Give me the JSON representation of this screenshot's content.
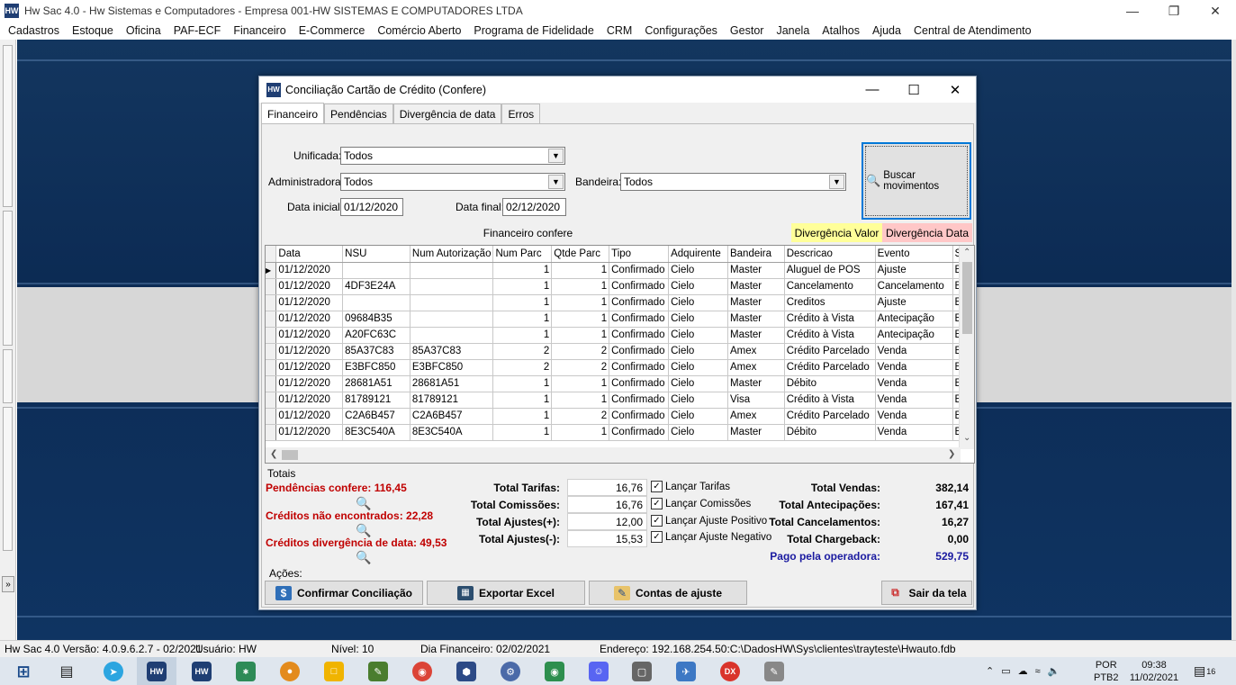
{
  "window": {
    "title": "Hw Sac 4.0 - Hw Sistemas e Computadores - Empresa 001-HW SISTEMAS E COMPUTADORES LTDA",
    "logo_text": "HW"
  },
  "menu": [
    "Cadastros",
    "Estoque",
    "Oficina",
    "PAF-ECF",
    "Financeiro",
    "E-Commerce",
    "Comércio Aberto",
    "Programa de Fidelidade",
    "CRM",
    "Configurações",
    "Gestor",
    "Janela",
    "Atalhos",
    "Ajuda",
    "Central de Atendimento"
  ],
  "dialog": {
    "title": "Conciliação Cartão de Crédito (Confere)",
    "tabs": [
      "Financeiro",
      "Pendências",
      "Divergência de data",
      "Erros"
    ],
    "filters": {
      "unificada_label": "Unificada:",
      "unificada_value": "Todos",
      "administradora_label": "Administradora:",
      "administradora_value": "Todos",
      "bandeira_label": "Bandeira:",
      "bandeira_value": "Todos",
      "data_inicial_label": "Data inicial:",
      "data_inicial_value": "01/12/2020",
      "data_final_label": "Data final:",
      "data_final_value": "02/12/2020"
    },
    "search_button": "Buscar movimentos",
    "legend": {
      "financeiro": "Financeiro confere",
      "valor": "Divergência Valor",
      "data": "Divergência Data",
      "valor_color": "#ffff99",
      "data_color": "#ffc7c7"
    },
    "grid": {
      "columns": [
        "Data",
        "NSU",
        "Num Autorização",
        "Num Parc",
        "Qtde Parc",
        "Tipo",
        "Adquirente",
        "Bandeira",
        "Descricao",
        "Evento",
        "Si"
      ],
      "rows": [
        [
          "01/12/2020",
          "",
          "",
          "1",
          "1",
          "Confirmado",
          "Cielo",
          "Master",
          "Aluguel de POS",
          "Ajuste",
          "Ex"
        ],
        [
          "01/12/2020",
          "4DF3E24A",
          "",
          "1",
          "1",
          "Confirmado",
          "Cielo",
          "Master",
          "Cancelamento",
          "Cancelamento",
          "Ex"
        ],
        [
          "01/12/2020",
          "",
          "",
          "1",
          "1",
          "Confirmado",
          "Cielo",
          "Master",
          "Creditos",
          "Ajuste",
          "Ex"
        ],
        [
          "01/12/2020",
          "09684B35",
          "",
          "1",
          "1",
          "Confirmado",
          "Cielo",
          "Master",
          "Crédito à Vista",
          "Antecipação",
          "Ex"
        ],
        [
          "01/12/2020",
          "A20FC63C",
          "",
          "1",
          "1",
          "Confirmado",
          "Cielo",
          "Master",
          "Crédito à Vista",
          "Antecipação",
          "Ex"
        ],
        [
          "01/12/2020",
          "85A37C83",
          "85A37C83",
          "2",
          "2",
          "Confirmado",
          "Cielo",
          "Amex",
          "Crédito Parcelado",
          "Venda",
          "Ex"
        ],
        [
          "01/12/2020",
          "E3BFC850",
          "E3BFC850",
          "2",
          "2",
          "Confirmado",
          "Cielo",
          "Amex",
          "Crédito Parcelado",
          "Venda",
          "Ex"
        ],
        [
          "01/12/2020",
          "28681A51",
          "28681A51",
          "1",
          "1",
          "Confirmado",
          "Cielo",
          "Master",
          "Débito",
          "Venda",
          "Ex"
        ],
        [
          "01/12/2020",
          "81789121",
          "81789121",
          "1",
          "1",
          "Confirmado",
          "Cielo",
          "Visa",
          "Crédito à Vista",
          "Venda",
          "Ex"
        ],
        [
          "01/12/2020",
          "C2A6B457",
          "C2A6B457",
          "1",
          "2",
          "Confirmado",
          "Cielo",
          "Amex",
          "Crédito Parcelado",
          "Venda",
          "Ex"
        ],
        [
          "01/12/2020",
          "8E3C540A",
          "8E3C540A",
          "1",
          "1",
          "Confirmado",
          "Cielo",
          "Master",
          "Débito",
          "Venda",
          "Ex"
        ]
      ]
    },
    "totais": {
      "group_label": "Totais",
      "pendencias": "Pendências confere: 116,45",
      "creditos_nao": "Créditos não encontrados: 22,28",
      "creditos_div": "Créditos divergência de data: 49,53",
      "tarifas_label": "Total Tarifas:",
      "tarifas_value": "16,76",
      "comissoes_label": "Total Comissões:",
      "comissoes_value": "16,76",
      "ajustes_pos_label": "Total Ajustes(+):",
      "ajustes_pos_value": "12,00",
      "ajustes_neg_label": "Total Ajustes(-):",
      "ajustes_neg_value": "15,53",
      "chk_tarifas": "Lançar Tarifas",
      "chk_comissoes": "Lançar Comissões",
      "chk_ajuste_pos": "Lançar Ajuste Positivo",
      "chk_ajuste_neg": "Lançar Ajuste Negativo",
      "vendas_label": "Total Vendas:",
      "vendas_value": "382,14",
      "antecipacoes_label": "Total Antecipações:",
      "antecipacoes_value": "167,41",
      "cancelamentos_label": "Total Cancelamentos:",
      "cancelamentos_value": "16,27",
      "chargeback_label": "Total Chargeback:",
      "chargeback_value": "0,00",
      "pago_label": "Pago pela operadora:",
      "pago_value": "529,75"
    },
    "acoes": {
      "group_label": "Ações:",
      "confirmar": "Confirmar Conciliação",
      "exportar": "Exportar Excel",
      "contas": "Contas de ajuste",
      "sair": "Sair da tela"
    }
  },
  "statusbar": {
    "version": "Hw Sac 4.0 Versão: 4.0.9.6.2.7 - 02/2021",
    "usuario": "Usuário: HW",
    "nivel": "Nível: 10",
    "dia": "Dia Financeiro: 02/02/2021",
    "endereco": "Endereço: 192.168.254.50:C:\\DadosHW\\Sys\\clientes\\trayteste\\Hwauto.fdb"
  },
  "taskbar": {
    "lang1": "POR",
    "lang2": "PTB2",
    "time": "09:38",
    "date": "11/02/2021",
    "notifications": "16"
  }
}
